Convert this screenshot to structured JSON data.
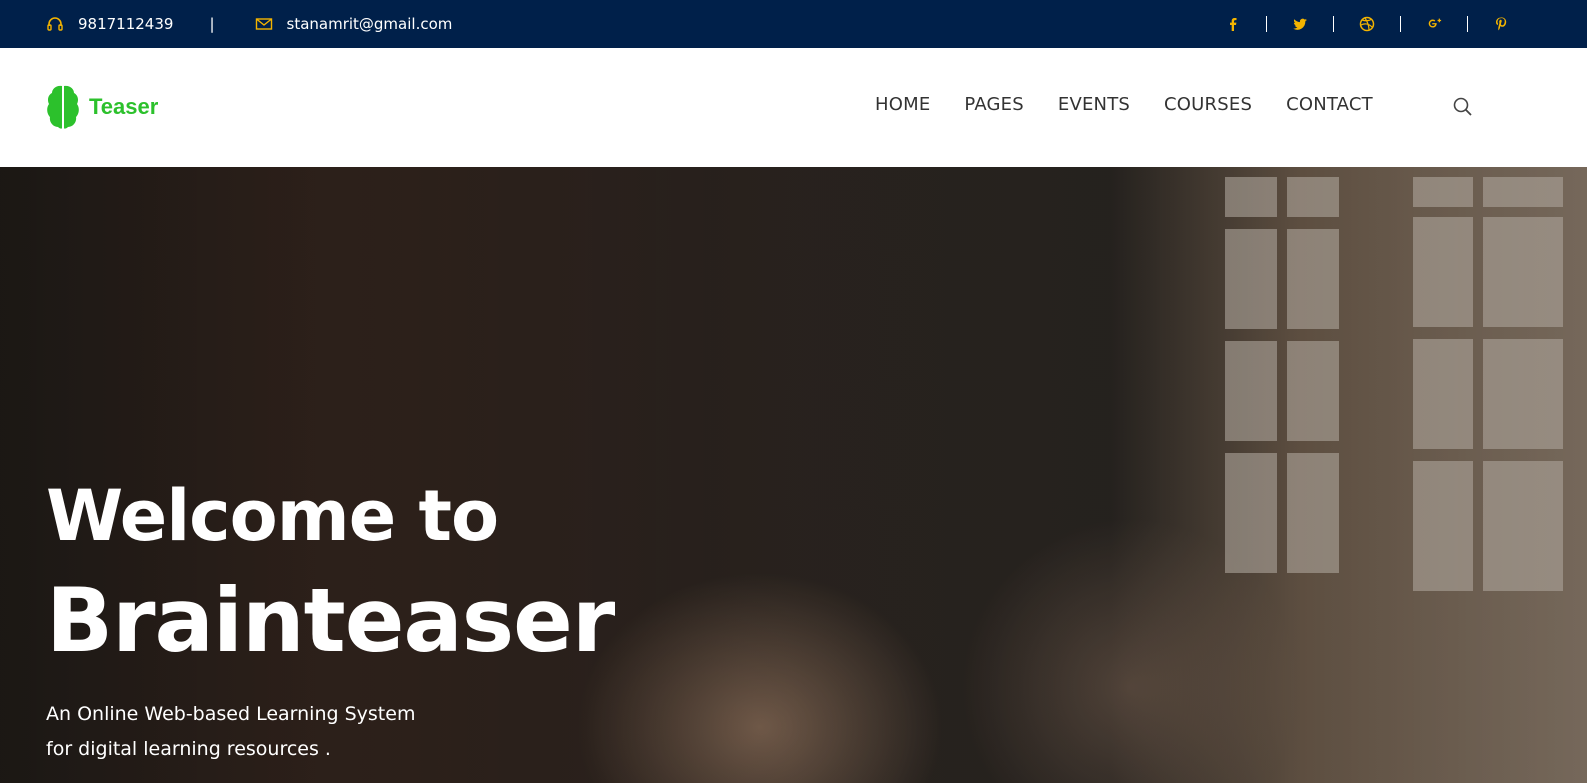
{
  "topbar": {
    "phone": "9817112439",
    "separator": "|",
    "email": "stanamrit@gmail.com",
    "socials": [
      {
        "icon": "facebook-icon",
        "glyph": "f"
      },
      {
        "icon": "twitter-icon",
        "glyph": "t"
      },
      {
        "icon": "dribbble-icon",
        "glyph": "d"
      },
      {
        "icon": "google-plus-icon",
        "glyph": "g+"
      },
      {
        "icon": "pinterest-icon",
        "glyph": "p"
      }
    ],
    "accent_color": "#f4b400",
    "background_color": "#00204a"
  },
  "header": {
    "logo_text": "Teaser",
    "logo_color": "#2cc12c",
    "nav": [
      "HOME",
      "PAGES",
      "EVENTS",
      "COURSES",
      "CONTACT"
    ]
  },
  "hero": {
    "title_line1": "Welcome to",
    "title_line2": "Brainteaser",
    "subtitle_line1": "An Online Web-based Learning System",
    "subtitle_line2": "for digital learning resources ."
  }
}
